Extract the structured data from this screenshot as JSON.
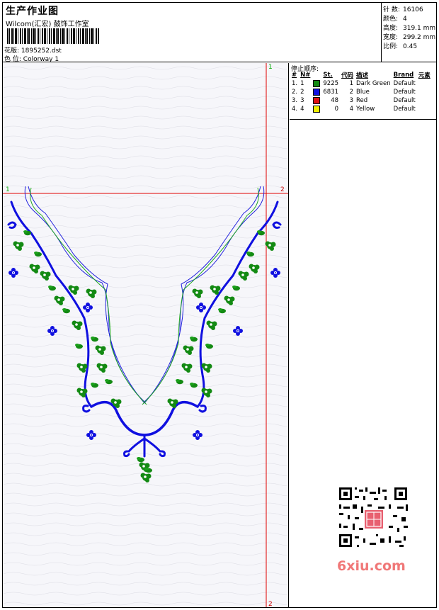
{
  "header": {
    "title": "生产作业图",
    "company": "Wilcom(汇宏) 鼓饰工作室",
    "design_label": "花版:",
    "design_file": "1895252.dst",
    "colorway_label": "色 位:",
    "colorway": "Colorway 1"
  },
  "stats": {
    "stitches": {
      "label": "针 数:",
      "value": "16106"
    },
    "colors": {
      "label": "颜色:",
      "value": "4"
    },
    "height": {
      "label": "高度:",
      "value": "319.1 mm"
    },
    "width": {
      "label": "宽度:",
      "value": "299.2 mm"
    },
    "scale": {
      "label": "比例:",
      "value": "0.45"
    }
  },
  "stop_sequence": {
    "title": "停止顺序:",
    "headers": [
      "#",
      "N#",
      "St.",
      "代码",
      "描述",
      "Brand",
      "元素"
    ],
    "rows": [
      {
        "idx": "1.",
        "n": "1",
        "color": "#138a13",
        "st": "9225",
        "code": "1",
        "desc": "Dark Green",
        "brand": "Default"
      },
      {
        "idx": "2.",
        "n": "2",
        "color": "#1010e0",
        "st": "6831",
        "code": "2",
        "desc": "Blue",
        "brand": "Default"
      },
      {
        "idx": "3.",
        "n": "3",
        "color": "#e01010",
        "st": "48",
        "code": "3",
        "desc": "Red",
        "brand": "Default"
      },
      {
        "idx": "4.",
        "n": "4",
        "color": "#f0f000",
        "st": "0",
        "code": "4",
        "desc": "Yellow",
        "brand": "Default"
      }
    ]
  },
  "markers": {
    "h_left": "1",
    "h_right": "2",
    "v_top": "1",
    "v_bottom": "2"
  },
  "watermark": {
    "text": "6xiu.com",
    "color": "#f07878"
  },
  "colors": {
    "green": "#138a13",
    "blue": "#1010e0",
    "guide": "#e00000"
  }
}
